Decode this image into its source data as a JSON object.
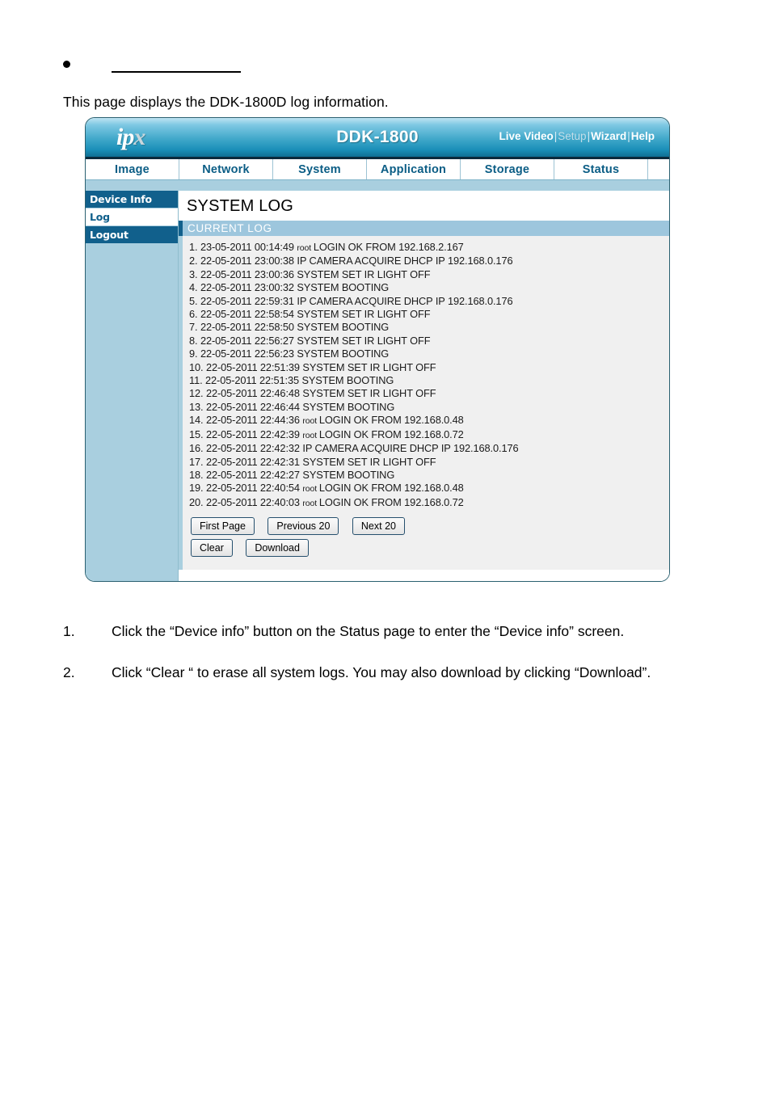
{
  "document": {
    "bullet_heading": "",
    "intro": "This page displays the DDK-1800D log information.",
    "steps": [
      {
        "num": "1.",
        "text": "Click the “Device info” button on the Status page to enter the “Device info” screen."
      },
      {
        "num": "2.",
        "text": "Click “Clear “ to erase all system logs. You may also download by clicking “Download”."
      }
    ]
  },
  "device_ui": {
    "header": {
      "logo_text": "ip",
      "logo_accent": "x",
      "model": "DDK-1800",
      "links": [
        {
          "label": "Live Video",
          "dim": false
        },
        {
          "label": "Setup",
          "dim": true
        },
        {
          "label": "Wizard",
          "dim": false
        },
        {
          "label": "Help",
          "dim": false
        }
      ],
      "separator": "|"
    },
    "tabs": [
      {
        "label": "Image"
      },
      {
        "label": "Network"
      },
      {
        "label": "System"
      },
      {
        "label": "Application"
      },
      {
        "label": "Storage"
      },
      {
        "label": "Status"
      }
    ],
    "sidebar": {
      "items": [
        {
          "label": "Device Info",
          "selected": false
        },
        {
          "label": "Log",
          "selected": true
        },
        {
          "label": "Logout",
          "selected": false
        }
      ]
    },
    "content": {
      "title": "SYSTEM LOG",
      "section_header": "CURRENT LOG",
      "log_entries": [
        {
          "index": "1.",
          "date": "23-05-2011",
          "time": "00:14:49",
          "user": "root",
          "message": "LOGIN OK FROM 192.168.2.167"
        },
        {
          "index": "2.",
          "date": "22-05-2011",
          "time": "23:00:38",
          "user": "",
          "message": "IP CAMERA ACQUIRE DHCP IP 192.168.0.176"
        },
        {
          "index": "3.",
          "date": "22-05-2011",
          "time": "23:00:36",
          "user": "",
          "message": "SYSTEM SET IR LIGHT OFF"
        },
        {
          "index": "4.",
          "date": "22-05-2011",
          "time": "23:00:32",
          "user": "",
          "message": "SYSTEM BOOTING"
        },
        {
          "index": "5.",
          "date": "22-05-2011",
          "time": "22:59:31",
          "user": "",
          "message": "IP CAMERA ACQUIRE DHCP IP 192.168.0.176"
        },
        {
          "index": "6.",
          "date": "22-05-2011",
          "time": "22:58:54",
          "user": "",
          "message": "SYSTEM SET IR LIGHT OFF"
        },
        {
          "index": "7.",
          "date": "22-05-2011",
          "time": "22:58:50",
          "user": "",
          "message": "SYSTEM BOOTING"
        },
        {
          "index": "8.",
          "date": "22-05-2011",
          "time": "22:56:27",
          "user": "",
          "message": "SYSTEM SET IR LIGHT OFF"
        },
        {
          "index": "9.",
          "date": "22-05-2011",
          "time": "22:56:23",
          "user": "",
          "message": "SYSTEM BOOTING"
        },
        {
          "index": "10.",
          "date": "22-05-2011",
          "time": "22:51:39",
          "user": "",
          "message": "SYSTEM SET IR LIGHT OFF"
        },
        {
          "index": "11.",
          "date": "22-05-2011",
          "time": "22:51:35",
          "user": "",
          "message": "SYSTEM BOOTING"
        },
        {
          "index": "12.",
          "date": "22-05-2011",
          "time": "22:46:48",
          "user": "",
          "message": "SYSTEM SET IR LIGHT OFF"
        },
        {
          "index": "13.",
          "date": "22-05-2011",
          "time": "22:46:44",
          "user": "",
          "message": "SYSTEM BOOTING"
        },
        {
          "index": "14.",
          "date": "22-05-2011",
          "time": "22:44:36",
          "user": "root",
          "message": "LOGIN OK FROM 192.168.0.48"
        },
        {
          "index": "15.",
          "date": "22-05-2011",
          "time": "22:42:39",
          "user": "root",
          "message": "LOGIN OK FROM 192.168.0.72"
        },
        {
          "index": "16.",
          "date": "22-05-2011",
          "time": "22:42:32",
          "user": "",
          "message": "IP CAMERA ACQUIRE DHCP IP 192.168.0.176"
        },
        {
          "index": "17.",
          "date": "22-05-2011",
          "time": "22:42:31",
          "user": "",
          "message": "SYSTEM SET IR LIGHT OFF"
        },
        {
          "index": "18.",
          "date": "22-05-2011",
          "time": "22:42:27",
          "user": "",
          "message": "SYSTEM BOOTING"
        },
        {
          "index": "19.",
          "date": "22-05-2011",
          "time": "22:40:54",
          "user": "root",
          "message": "LOGIN OK FROM 192.168.0.48"
        },
        {
          "index": "20.",
          "date": "22-05-2011",
          "time": "22:40:03",
          "user": "root",
          "message": "LOGIN OK FROM 192.168.0.72"
        }
      ],
      "buttons_row1": [
        {
          "label": "First Page",
          "name": "first-page-button"
        },
        {
          "label": "Previous 20",
          "name": "previous-20-button"
        },
        {
          "label": "Next 20",
          "name": "next-20-button"
        }
      ],
      "buttons_row2": [
        {
          "label": "Clear",
          "name": "clear-button"
        },
        {
          "label": "Download",
          "name": "download-button"
        }
      ]
    }
  },
  "colors": {
    "nav_blue": "#0b5d85",
    "sidebar_blue": "#a9cfdf",
    "sidebar_item_blue": "#11608c",
    "section_bar_blue": "#9dc6dd",
    "log_bg": "#f0f0f0"
  }
}
